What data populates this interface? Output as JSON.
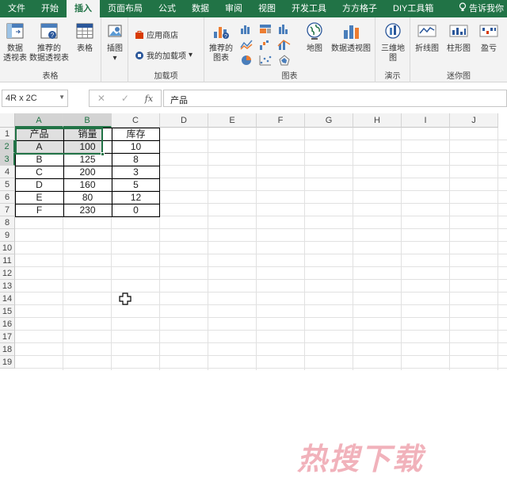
{
  "tabs": [
    "文件",
    "开始",
    "插入",
    "页面布局",
    "公式",
    "数据",
    "审阅",
    "视图",
    "开发工具",
    "方方格子",
    "DIY工具箱"
  ],
  "active_tab": "插入",
  "tell_me": "告诉我你",
  "ribbon": {
    "tables": {
      "label": "表格",
      "pivot": [
        "数据",
        "透视表"
      ],
      "recommended_pivot": [
        "推荐的",
        "数据透视表"
      ],
      "table": "表格"
    },
    "illustrations": {
      "label": "插图",
      "dropdown": "▾"
    },
    "addins": {
      "label": "加载项",
      "store": "应用商店",
      "my_addins": "我的加载项",
      "dropdown": "▾"
    },
    "charts": {
      "label": "图表",
      "recommended": [
        "推荐的",
        "图表"
      ],
      "map": "地图",
      "pivot_chart": "数据透视图"
    },
    "tours": {
      "label": "演示",
      "map3d": [
        "三维地",
        "图"
      ]
    },
    "sparklines": {
      "label": "迷你图",
      "line": "折线图",
      "column": "柱形图",
      "winloss": "盈亏"
    }
  },
  "formula_bar": {
    "name_box": "4R x 2C",
    "cancel": "✕",
    "enter": "✓",
    "fx": "fx",
    "value": "产品"
  },
  "columns": [
    "A",
    "B",
    "C",
    "D",
    "E",
    "F",
    "G",
    "H",
    "I",
    "J"
  ],
  "rows": [
    "1",
    "2",
    "3",
    "4",
    "5",
    "6",
    "7",
    "8",
    "9",
    "10",
    "11",
    "12",
    "13",
    "14",
    "15",
    "16",
    "17",
    "18",
    "19"
  ],
  "table": {
    "headers": [
      "产品",
      "销量",
      "库存"
    ],
    "rows": [
      [
        "A",
        "100",
        "10"
      ],
      [
        "B",
        "125",
        "8"
      ],
      [
        "C",
        "200",
        "3"
      ],
      [
        "D",
        "160",
        "5"
      ],
      [
        "E",
        "80",
        "12"
      ],
      [
        "F",
        "230",
        "0"
      ]
    ]
  },
  "watermark": "热搜下载",
  "colors": {
    "accent": "#217346",
    "ribbon_bg": "#f3f3f3"
  }
}
